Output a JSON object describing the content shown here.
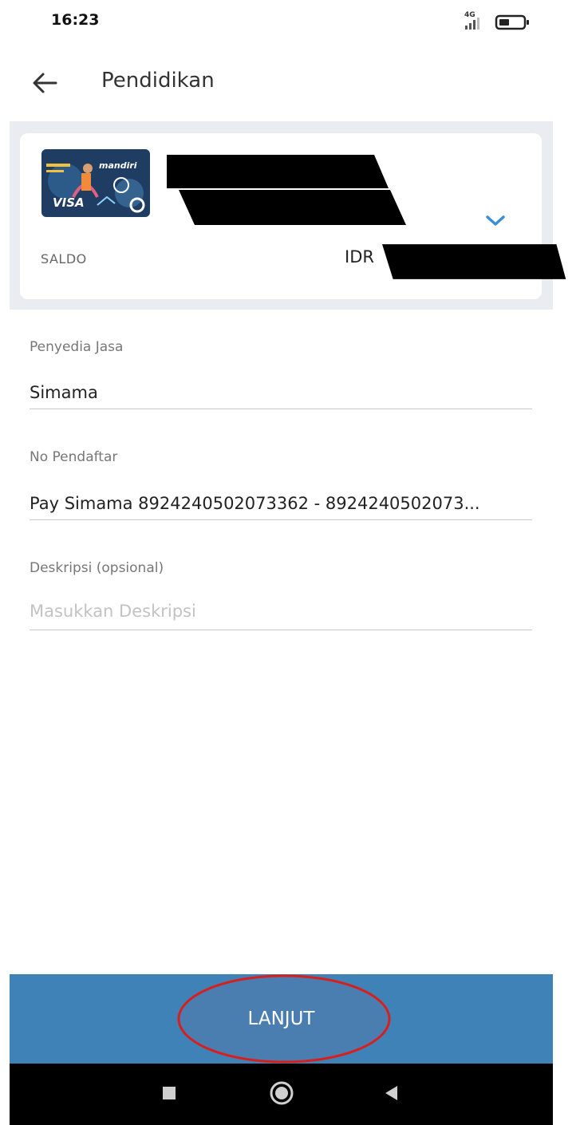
{
  "status_bar": {
    "time": "16:23",
    "network": "4G"
  },
  "header": {
    "title": "Pendidikan"
  },
  "account": {
    "saldo_label": "SALDO",
    "currency": "IDR",
    "card_brand": "mandiri",
    "card_network": "VISA"
  },
  "form": {
    "provider": {
      "label": "Penyedia Jasa",
      "value": "Simama"
    },
    "registration": {
      "label": "No Pendaftar",
      "value": "Pay Simama 8924240502073362 - 8924240502073..."
    },
    "description": {
      "label": "Deskripsi (opsional)",
      "placeholder": "Masukkan Deskripsi"
    }
  },
  "continue_button": {
    "label": "LANJUT"
  },
  "colors": {
    "accent": "#3f82b7",
    "chevron": "#3b8ed8",
    "highlight": "#d62020"
  }
}
